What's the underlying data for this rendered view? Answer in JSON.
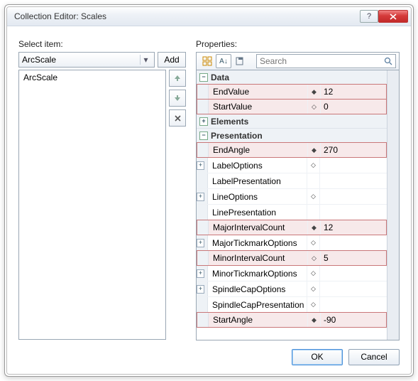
{
  "window": {
    "title": "Collection Editor: Scales"
  },
  "left": {
    "section_label": "Select item:",
    "combo_value": "ArcScale",
    "add_label": "Add",
    "items": [
      "ArcScale"
    ]
  },
  "right": {
    "section_label": "Properties:",
    "search_placeholder": "Search"
  },
  "categories": {
    "data": "Data",
    "elements": "Elements",
    "presentation": "Presentation"
  },
  "props": {
    "data": [
      {
        "name": "EndValue",
        "marker": "◆",
        "value": "12",
        "hl": true,
        "exp": false
      },
      {
        "name": "StartValue",
        "marker": "◇",
        "value": "0",
        "hl": true,
        "exp": false
      }
    ],
    "presentation": [
      {
        "name": "EndAngle",
        "marker": "◆",
        "value": "270",
        "hl": true,
        "exp": false
      },
      {
        "name": "LabelOptions",
        "marker": "◇",
        "value": "",
        "hl": false,
        "exp": true
      },
      {
        "name": "LabelPresentation",
        "marker": "",
        "value": "",
        "hl": false,
        "exp": false
      },
      {
        "name": "LineOptions",
        "marker": "◇",
        "value": "",
        "hl": false,
        "exp": true
      },
      {
        "name": "LinePresentation",
        "marker": "",
        "value": "",
        "hl": false,
        "exp": false
      },
      {
        "name": "MajorIntervalCount",
        "marker": "◆",
        "value": "12",
        "hl": true,
        "exp": false
      },
      {
        "name": "MajorTickmarkOptions",
        "marker": "◇",
        "value": "",
        "hl": false,
        "exp": true
      },
      {
        "name": "MinorIntervalCount",
        "marker": "◇",
        "value": "5",
        "hl": true,
        "exp": false
      },
      {
        "name": "MinorTickmarkOptions",
        "marker": "◇",
        "value": "",
        "hl": false,
        "exp": true
      },
      {
        "name": "SpindleCapOptions",
        "marker": "◇",
        "value": "",
        "hl": false,
        "exp": true
      },
      {
        "name": "SpindleCapPresentation",
        "marker": "◇",
        "value": "",
        "hl": false,
        "exp": false
      },
      {
        "name": "StartAngle",
        "marker": "◆",
        "value": "-90",
        "hl": true,
        "exp": false
      }
    ]
  },
  "footer": {
    "ok": "OK",
    "cancel": "Cancel"
  }
}
